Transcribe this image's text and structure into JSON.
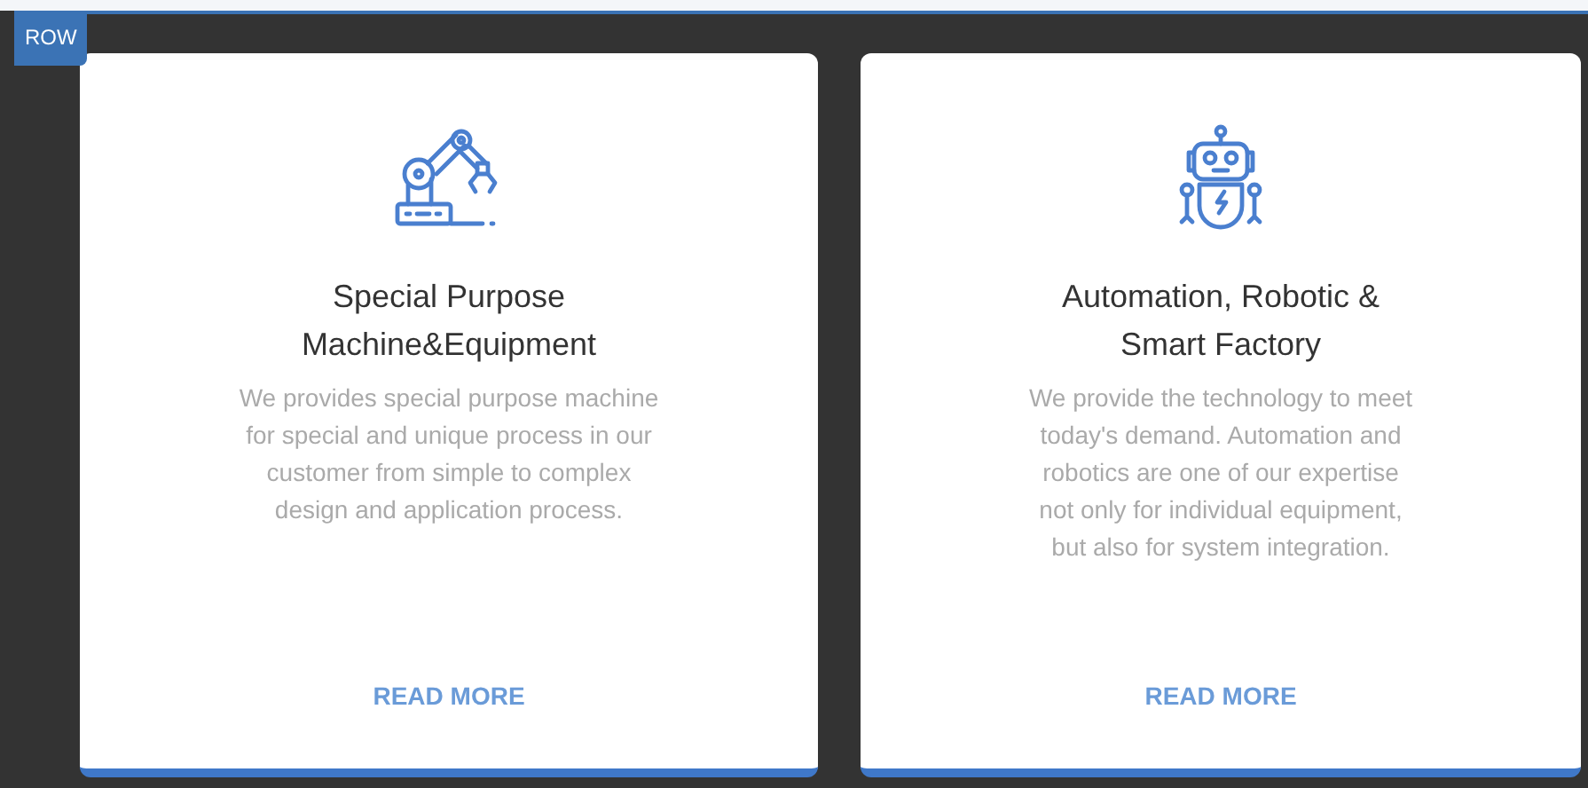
{
  "badge": "ROW",
  "cards": [
    {
      "kind": "robot-arm",
      "title": "Special Purpose Machine&Equipment",
      "text": "We provides special purpose machine for special and unique process in our customer from simple to complex design and application process.",
      "link": "READ MORE"
    },
    {
      "kind": "robot",
      "title": "Automation, Robotic & Smart Factory",
      "text": "We provide the technology to meet today's demand. Automation and robotics are one of our expertise not only for individual equipment, but also for system integration.",
      "link": "READ MORE"
    }
  ]
}
